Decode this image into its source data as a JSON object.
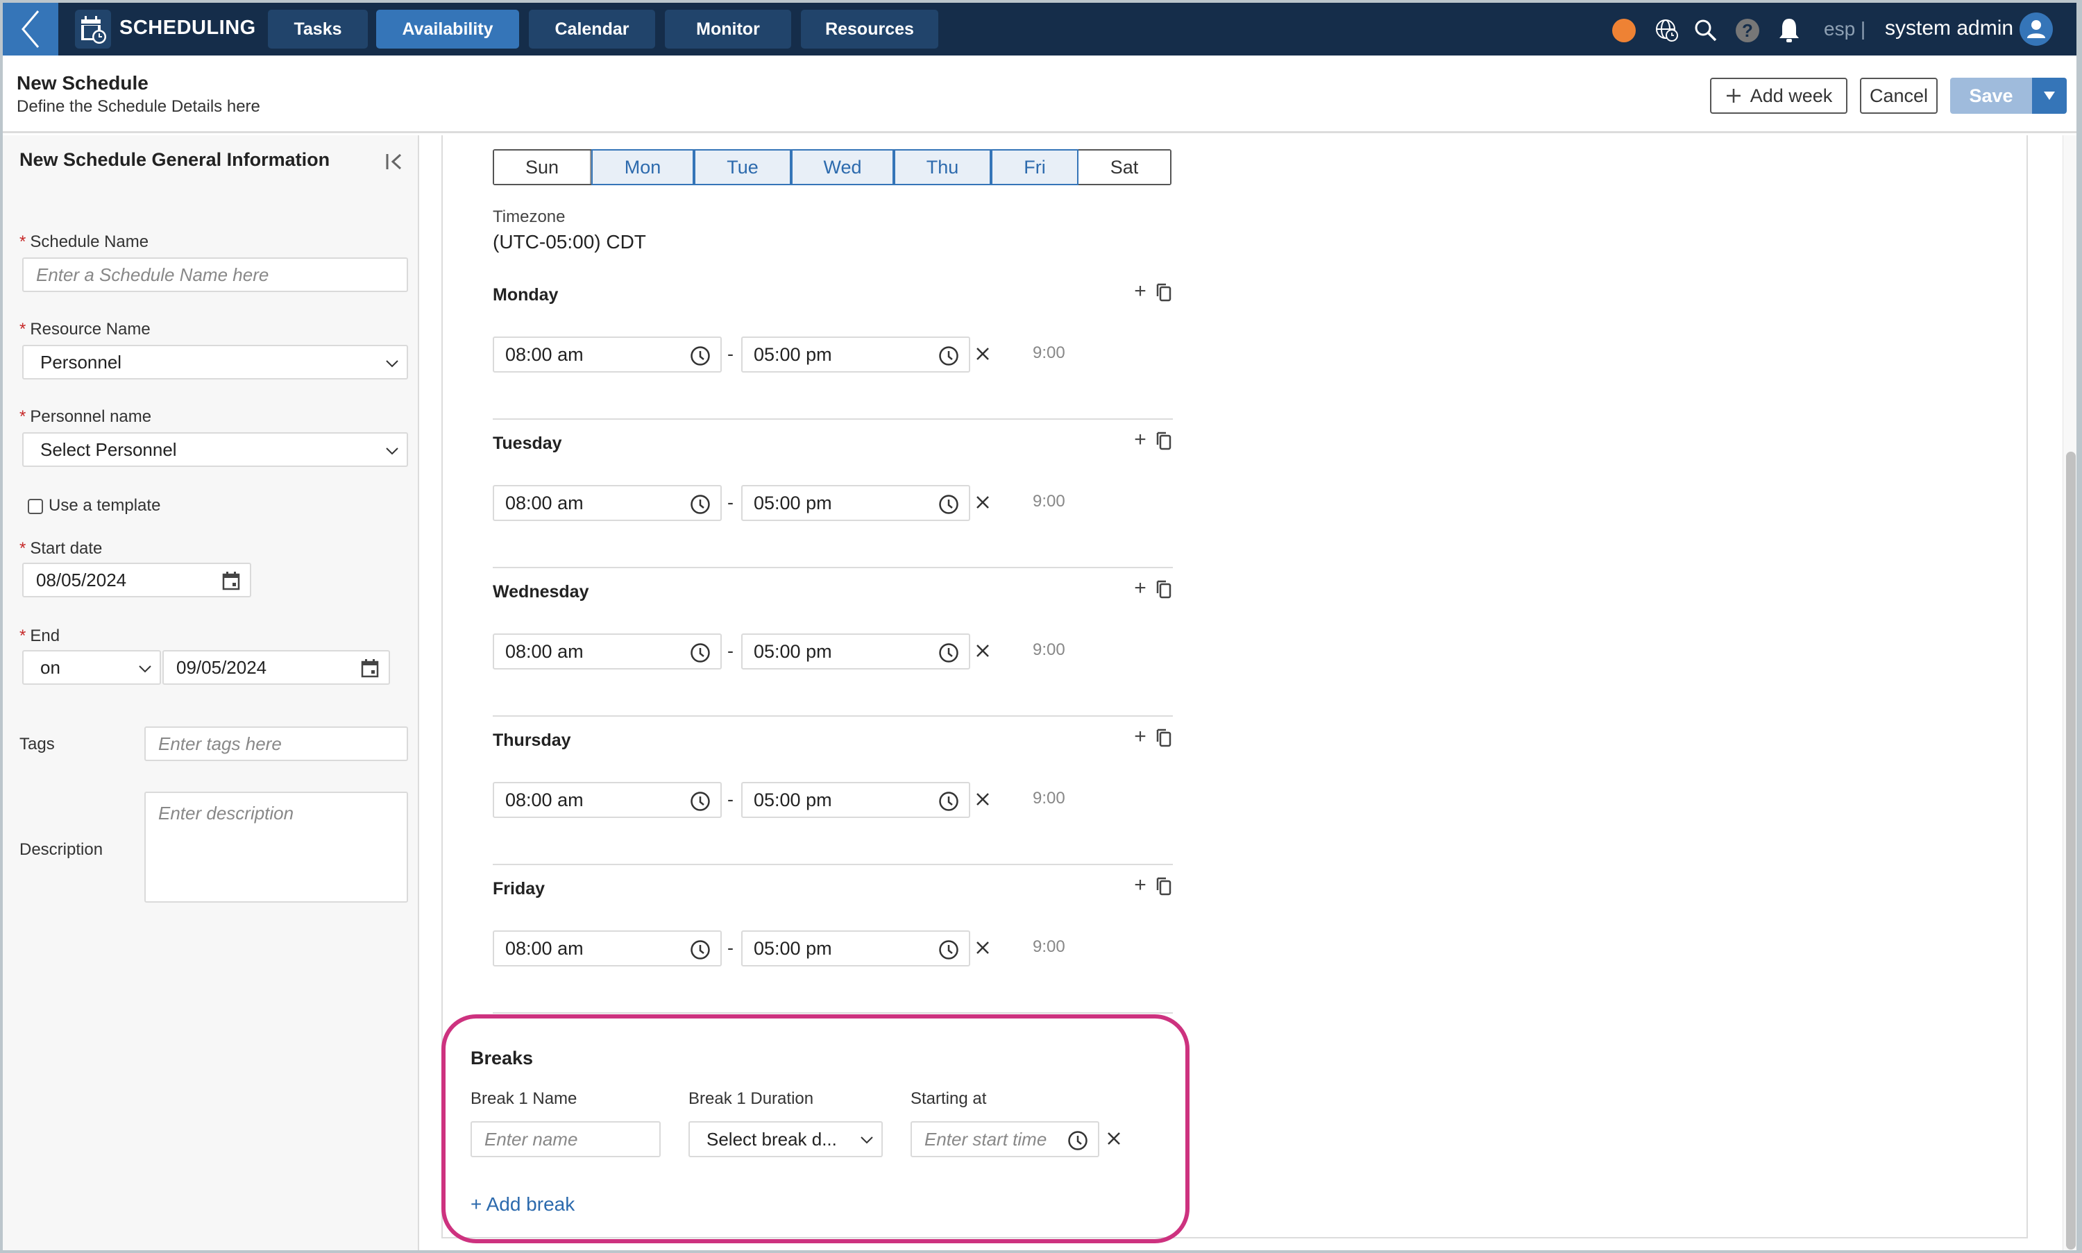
{
  "app": {
    "title": "SCHEDULING",
    "nav_tabs": [
      {
        "label": "Tasks",
        "active": false
      },
      {
        "label": "Availability",
        "active": true
      },
      {
        "label": "Calendar",
        "active": false
      },
      {
        "label": "Monitor",
        "active": false
      },
      {
        "label": "Resources",
        "active": false
      }
    ],
    "language": "esp |",
    "user": "system admin",
    "icons": [
      "status-dot",
      "timezone-globe-icon",
      "search-icon",
      "help-icon",
      "bell-icon",
      "user-avatar-icon"
    ],
    "colors": {
      "topbar": "#152d4a",
      "accent": "#3575b8",
      "status_dot": "#ee8234",
      "highlight": "#cd327f"
    }
  },
  "header": {
    "title": "New Schedule",
    "subtitle": "Define the Schedule Details here",
    "add_week": "Add week",
    "cancel": "Cancel",
    "save": "Save"
  },
  "sidebar": {
    "title": "New Schedule General Information",
    "schedule_name": {
      "label": "Schedule Name",
      "placeholder": "Enter a Schedule Name here",
      "required": true
    },
    "resource_name": {
      "label": "Resource Name",
      "value": "Personnel",
      "required": true
    },
    "personnel_name": {
      "label": "Personnel name",
      "value": "Select Personnel",
      "required": true
    },
    "use_template": {
      "label": "Use a template",
      "checked": false
    },
    "start_date": {
      "label": "Start date",
      "value": "08/05/2024",
      "required": true
    },
    "end": {
      "label": "End",
      "mode": "on",
      "value": "09/05/2024",
      "required": true
    },
    "tags": {
      "label": "Tags",
      "placeholder": "Enter tags here"
    },
    "description": {
      "label": "Description",
      "placeholder": "Enter description"
    },
    "required_mark": "*"
  },
  "week": {
    "days": [
      {
        "label": "Sun",
        "selected": false
      },
      {
        "label": "Mon",
        "selected": true
      },
      {
        "label": "Tue",
        "selected": true
      },
      {
        "label": "Wed",
        "selected": true
      },
      {
        "label": "Thu",
        "selected": true
      },
      {
        "label": "Fri",
        "selected": true
      },
      {
        "label": "Sat",
        "selected": false
      }
    ],
    "timezone_label": "Timezone",
    "timezone_value": "(UTC-05:00) CDT",
    "schedule": [
      {
        "day": "Monday",
        "start": "08:00 am",
        "end": "05:00 pm",
        "duration": "9:00"
      },
      {
        "day": "Tuesday",
        "start": "08:00 am",
        "end": "05:00 pm",
        "duration": "9:00"
      },
      {
        "day": "Wednesday",
        "start": "08:00 am",
        "end": "05:00 pm",
        "duration": "9:00"
      },
      {
        "day": "Thursday",
        "start": "08:00 am",
        "end": "05:00 pm",
        "duration": "9:00"
      },
      {
        "day": "Friday",
        "start": "08:00 am",
        "end": "05:00 pm",
        "duration": "9:00"
      }
    ],
    "separator": "-"
  },
  "breaks": {
    "title": "Breaks",
    "name_label": "Break 1 Name",
    "name_placeholder": "Enter name",
    "duration_label": "Break 1 Duration",
    "duration_value": "Select break d...",
    "start_label": "Starting at",
    "start_placeholder": "Enter start time",
    "add_break": "+ Add break"
  }
}
